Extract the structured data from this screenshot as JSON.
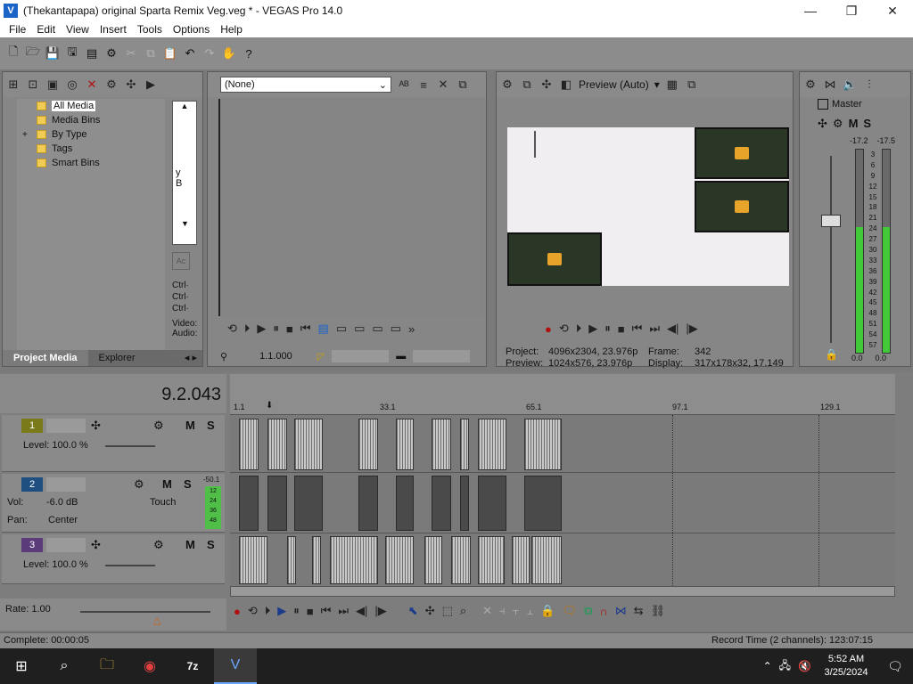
{
  "window": {
    "title": "(Thekantapapa) original Sparta Remix Veg.veg * - VEGAS Pro 14.0",
    "minimize": "—",
    "maximize": "❐",
    "close": "✕"
  },
  "menu": [
    "File",
    "Edit",
    "View",
    "Insert",
    "Tools",
    "Options",
    "Help"
  ],
  "project_media": {
    "tree": [
      "All Media",
      "Media Bins",
      "By Type",
      "Tags",
      "Smart Bins"
    ],
    "expander": "+",
    "side_text": [
      "y",
      "B"
    ],
    "ctrl_labels": [
      "Ctrl·",
      "Ctrl·",
      "Ctrl·"
    ],
    "video_label": "Video:",
    "audio_label": "Audio:",
    "tabs": [
      "Project Media",
      "Explorer"
    ]
  },
  "trimmer": {
    "dropdown_value": "(None)",
    "timecode": "1.1.000"
  },
  "preview": {
    "mode_label": "Preview (Auto)",
    "project_label": "Project:",
    "project_value": "4096x2304, 23.976p",
    "preview_label": "Preview:",
    "preview_value": "1024x576, 23.976p",
    "frame_label": "Frame:",
    "frame_value": "342",
    "display_label": "Display:",
    "display_value": "317x178x32, 17.149"
  },
  "master": {
    "title": "Master",
    "m": "M",
    "s": "S",
    "peak_left": "-17.2",
    "peak_right": "-17.5",
    "scale": [
      "3",
      "6",
      "9",
      "12",
      "15",
      "18",
      "21",
      "24",
      "27",
      "30",
      "33",
      "36",
      "39",
      "42",
      "45",
      "48",
      "51",
      "54",
      "57"
    ],
    "bottom_left": "0.0",
    "bottom_right": "0.0"
  },
  "timeline": {
    "cursor_time": "9.2.043",
    "ruler": [
      "1.1",
      "33.1",
      "65.1",
      "97.1",
      "129.1"
    ],
    "rate_label": "Rate: 1.00"
  },
  "tracks": [
    {
      "num": "1",
      "m": "M",
      "s": "S",
      "level": "Level: 100.0 %"
    },
    {
      "num": "2",
      "m": "M",
      "s": "S",
      "vol_label": "Vol:",
      "vol_value": "-6.0 dB",
      "pan_label": "Pan:",
      "pan_value": "Center",
      "touch": "Touch",
      "meter_top": "-50.1",
      "meter_scale": [
        "12",
        "24",
        "36",
        "48"
      ]
    },
    {
      "num": "3",
      "m": "M",
      "s": "S",
      "level": "Level: 100.0 %"
    }
  ],
  "status": {
    "complete": "Complete: 00:00:05",
    "record_time": "Record Time (2 channels): 123:07:15"
  },
  "taskbar": {
    "time": "5:52 AM",
    "date": "3/25/2024"
  },
  "colors": {
    "accent": "#1a64c8",
    "meter": "#41c93a",
    "folder": "#f0cc56"
  }
}
